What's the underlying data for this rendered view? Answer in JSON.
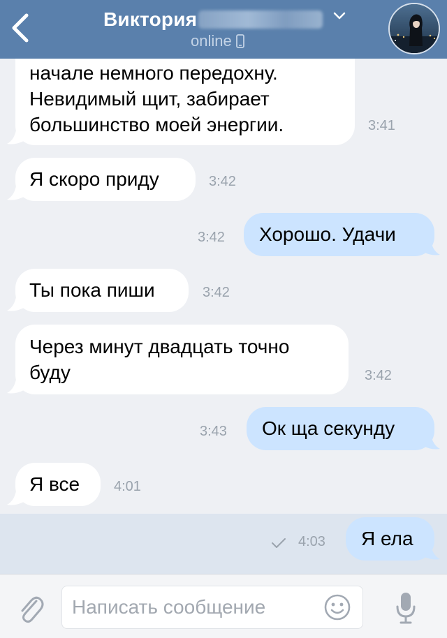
{
  "header": {
    "contact_name": "Виктория",
    "status": "online",
    "colors": {
      "bar": "#5a80ac",
      "status_text": "#c3d3e6"
    },
    "icons": [
      "back-arrow-icon",
      "chevron-down-icon",
      "mobile-phone-icon",
      "avatar"
    ]
  },
  "messages": [
    {
      "direction": "incoming",
      "text": "начале немного передохну.\nНевидимый щит, забирает\nбольшинство моей энергии.",
      "time": "3:41"
    },
    {
      "direction": "incoming",
      "text": "Я скоро приду",
      "time": "3:42"
    },
    {
      "direction": "outgoing",
      "text": "Хорошо. Удачи",
      "time": "3:42"
    },
    {
      "direction": "incoming",
      "text": "Ты пока пиши",
      "time": "3:42"
    },
    {
      "direction": "incoming",
      "text": "Через минут двадцать точно\nбуду",
      "time": "3:42"
    },
    {
      "direction": "outgoing",
      "text": "Ок ща секунду",
      "time": "3:43"
    },
    {
      "direction": "incoming",
      "text": "Я все",
      "time": "4:01"
    },
    {
      "direction": "outgoing",
      "text": "Я ела",
      "time": "4:03",
      "delivered": true,
      "highlighted": true
    }
  ],
  "composer": {
    "placeholder": "Написать сообщение",
    "icons": [
      "paperclip-icon",
      "emoji-icon",
      "microphone-icon"
    ]
  },
  "colors": {
    "background": "#eef0f4",
    "incoming_bubble": "#ffffff",
    "outgoing_bubble": "#cce4ff",
    "highlight_row": "#dde5ef"
  }
}
